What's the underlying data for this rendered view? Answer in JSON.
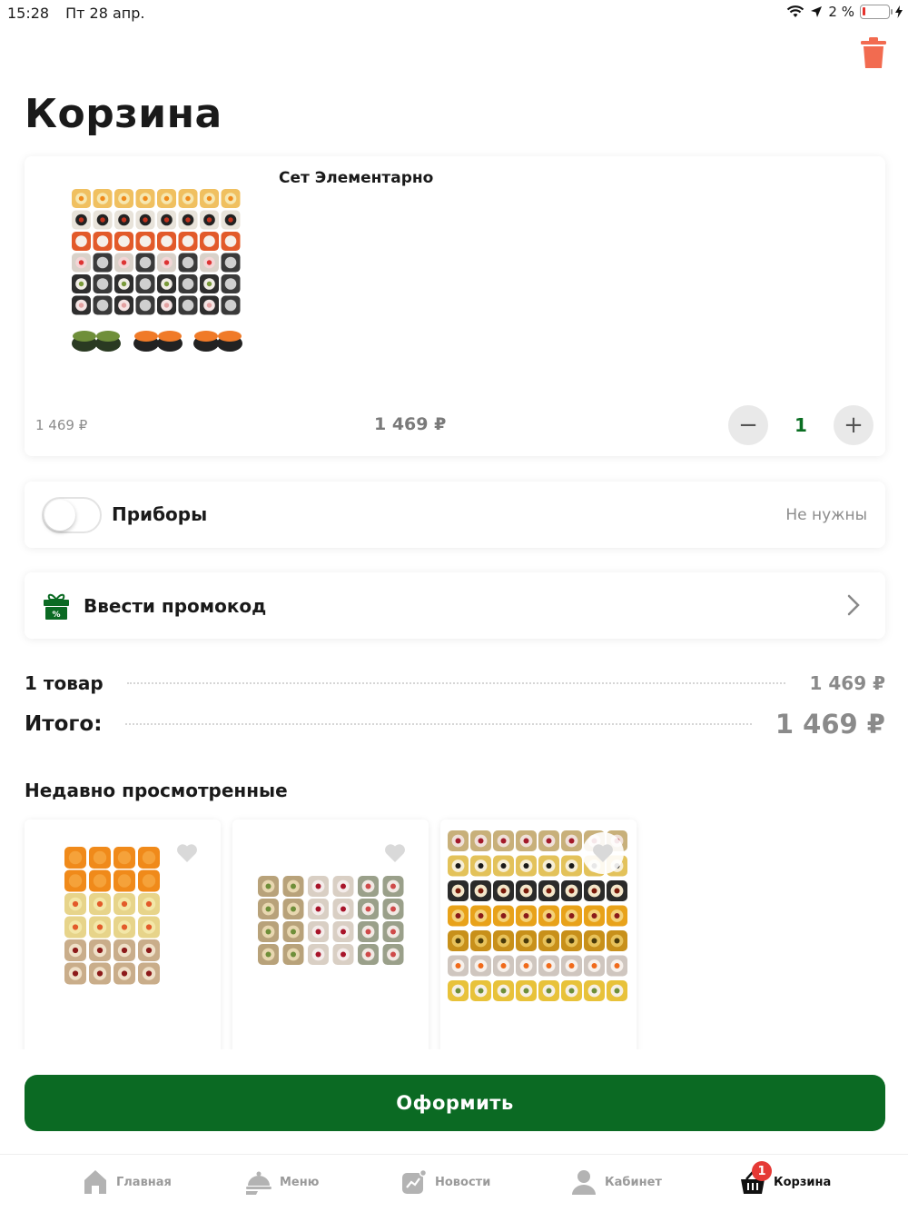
{
  "status_bar": {
    "time": "15:28",
    "date": "Пт 28 апр.",
    "battery": "2 %",
    "battery_level": 0.02
  },
  "page_title": "Корзина",
  "cart_item": {
    "name": "Сет Элементарно",
    "old_price": "1 469 ₽",
    "price": "1 469 ₽",
    "quantity": "1",
    "minus_label": "−",
    "plus_label": "+"
  },
  "cutlery": {
    "label": "Приборы",
    "state": "Не нужны",
    "enabled": false
  },
  "promo": {
    "label": "Ввести промокод"
  },
  "summary": {
    "items_label": "1 товар",
    "items_value": "1 469 ₽",
    "total_label": "Итого:",
    "total_value": "1 469 ₽"
  },
  "recent": {
    "title": "Недавно просмотренные"
  },
  "checkout_label": "Оформить",
  "tabbar": {
    "tabs": [
      {
        "label": "Главная",
        "icon": "home-icon"
      },
      {
        "label": "Меню",
        "icon": "cloche-icon"
      },
      {
        "label": "Новости",
        "icon": "news-icon"
      },
      {
        "label": "Кабинет",
        "icon": "person-icon"
      },
      {
        "label": "Корзина",
        "icon": "basket-icon",
        "badge": "1",
        "active": true
      }
    ]
  },
  "colors": {
    "brand_green": "#0b6a23",
    "trash": "#f26b50",
    "badge": "#e53935"
  }
}
